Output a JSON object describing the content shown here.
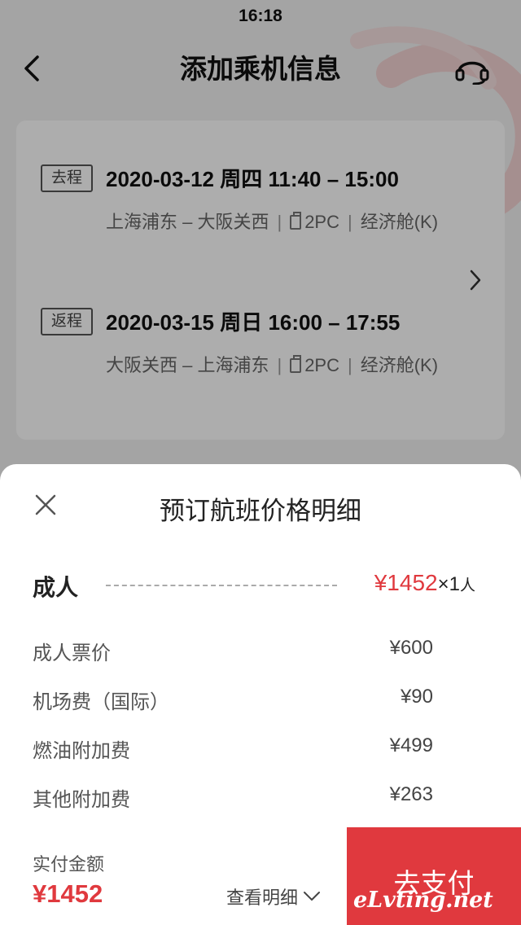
{
  "status_bar": {
    "time": "16:18"
  },
  "nav": {
    "title": "添加乘机信息",
    "back_icon": "chevron-left-icon",
    "service_icon": "headset-icon"
  },
  "flight_card": {
    "legs": [
      {
        "tag": "去程",
        "date_time": "2020-03-12 周四  11:40 – 15:00",
        "route": "上海浦东 – 大阪关西",
        "baggage": "2PC",
        "cabin": "经济舱(K)"
      },
      {
        "tag": "返程",
        "date_time": "2020-03-15 周日  16:00 – 17:55",
        "route": "大阪关西 – 上海浦东",
        "baggage": "2PC",
        "cabin": "经济舱(K)"
      }
    ]
  },
  "sheet": {
    "title": "预订航班价格明细",
    "adult": {
      "label": "成人",
      "price": "¥1452",
      "multiplier": "×1",
      "unit": "人"
    },
    "fees": [
      {
        "label": "成人票价",
        "value": "¥600"
      },
      {
        "label": "机场费（国际）",
        "value": "¥90"
      },
      {
        "label": "燃油附加费",
        "value": "¥499"
      },
      {
        "label": "其他附加费",
        "value": "¥263"
      }
    ],
    "footer": {
      "pay_label": "实付金额",
      "total": "¥1452",
      "detail_link": "查看明细",
      "pay_button": "去支付",
      "watermark": "eLvting.net"
    }
  },
  "colors": {
    "accent_red": "#e0393e",
    "overlay": "rgba(0,0,0,0.32)"
  }
}
